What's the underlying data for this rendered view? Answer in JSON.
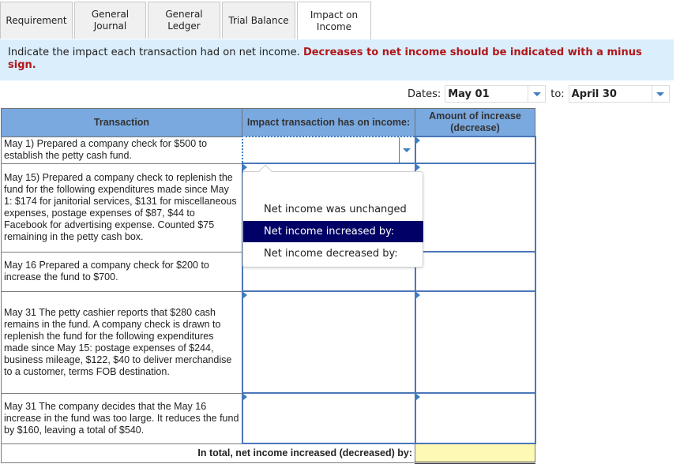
{
  "tabs": [
    {
      "label": "Requirement",
      "active": false
    },
    {
      "label": "General\nJournal",
      "active": false
    },
    {
      "label": "General\nLedger",
      "active": false
    },
    {
      "label": "Trial Balance",
      "active": false
    },
    {
      "label": "Impact on\nIncome",
      "active": true
    }
  ],
  "instructions": {
    "text": "Indicate the impact each transaction had on net income. ",
    "emphasis": "Decreases to net income should be indicated with a minus sign."
  },
  "dates": {
    "label": "Dates:",
    "from": "May 01",
    "to_label": "to:",
    "to": "April 30"
  },
  "table": {
    "headers": {
      "transaction": "Transaction",
      "impact": "Impact transaction has on income:",
      "amount": "Amount of increase (decrease)"
    },
    "rows": [
      {
        "transaction": "May 1) Prepared a company check for $500 to establish the petty cash fund.",
        "impact": "",
        "amount": ""
      },
      {
        "transaction": "May 15) Prepared a company check to replenish the fund for the following expenditures made since May 1: $174 for janitorial services, $131 for miscellaneous expenses, postage expenses of $87, $44 to Facebook for advertising expense. Counted $75 remaining in the petty cash box.",
        "impact": "",
        "amount": ""
      },
      {
        "transaction": "May 16 Prepared a company check for $200 to increase the fund to $700.",
        "impact": "",
        "amount": ""
      },
      {
        "transaction": "May 31 The petty cashier reports that $280 cash remains in the fund. A company check is drawn to replenish the fund for the following expenditures made since May 15: postage expenses of $244, business mileage, $122, $40 to deliver merchandise to a customer, terms FOB destination.",
        "impact": "",
        "amount": ""
      },
      {
        "transaction": "May 31 The company decides that the May 16 increase in the fund was too large. It reduces the fund by $160, leaving a total of $540.",
        "impact": "",
        "amount": ""
      }
    ],
    "total_label": "In total, net income increased (decreased) by:",
    "total_value": ""
  },
  "dropdown": {
    "options": [
      "",
      "Net income was unchanged",
      "Net income increased by:",
      "Net income decreased by:"
    ],
    "highlighted": "Net income increased by:"
  },
  "colors": {
    "header_bg": "#7aa9e0",
    "instruction_bg": "#dbeefb",
    "emphasis_red": "#b0161a",
    "highlight_navy": "#000066",
    "total_yellow": "#fef9b4"
  }
}
